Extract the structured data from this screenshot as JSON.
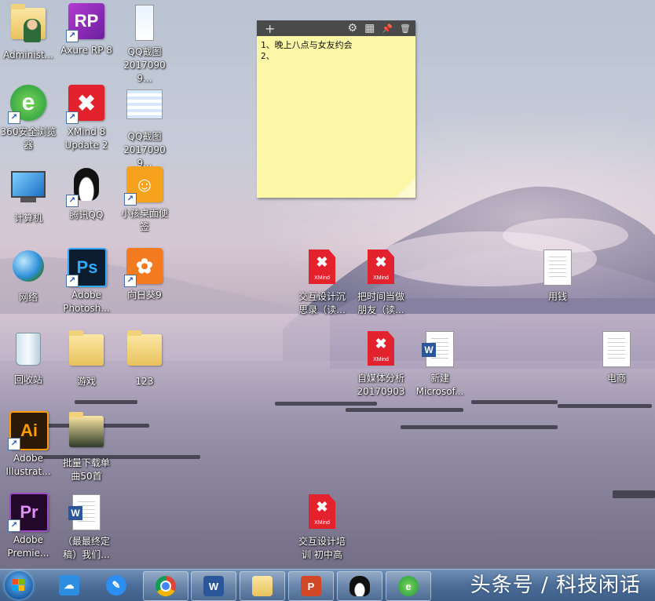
{
  "desktop_icons": [
    {
      "id": "admin",
      "label": "Administ..."
    },
    {
      "id": "axure",
      "label": "Axure RP 8"
    },
    {
      "id": "qqshot1",
      "label": "QQ截图\n20170909..."
    },
    {
      "id": "ie360",
      "label": "360安全浏览\n器"
    },
    {
      "id": "xmind8",
      "label": "XMind 8\nUpdate 2"
    },
    {
      "id": "qqshot2",
      "label": "QQ截图\n20170909..."
    },
    {
      "id": "computer",
      "label": "计算机"
    },
    {
      "id": "tencentqq",
      "label": "腾讯QQ"
    },
    {
      "id": "smallsticky",
      "label": "小孩桌面便\n签"
    },
    {
      "id": "network",
      "label": "网络"
    },
    {
      "id": "photoshop",
      "label": "Adobe\nPhotosh..."
    },
    {
      "id": "sunflower",
      "label": "向日葵9"
    },
    {
      "id": "xmind_jhsj",
      "label": "交互设计沉\n思录（读..."
    },
    {
      "id": "xmind_bsj",
      "label": "把时间当做\n朋友（读..."
    },
    {
      "id": "yongqian",
      "label": "用钱"
    },
    {
      "id": "recycle",
      "label": "回收站"
    },
    {
      "id": "games",
      "label": "游戏"
    },
    {
      "id": "f123",
      "label": "123"
    },
    {
      "id": "xmind_zmt",
      "label": "自媒体分析\n20170903"
    },
    {
      "id": "newword",
      "label": "新建\nMicrosof..."
    },
    {
      "id": "dianshang",
      "label": "电商"
    },
    {
      "id": "illustrator",
      "label": "Adobe\nIllustrat..."
    },
    {
      "id": "batchdl",
      "label": "批量下载单\n曲50首"
    },
    {
      "id": "premiere",
      "label": "Adobe\nPremie..."
    },
    {
      "id": "finaldoc",
      "label": "（最最终定\n稿）我们..."
    },
    {
      "id": "xmind_jhpx",
      "label": "交互设计培\n训 初中高"
    }
  ],
  "sticky_note": {
    "toolbar": {
      "add": "+",
      "settings": "⚙",
      "grid": "▦",
      "pin": "📌",
      "delete": "🗑"
    },
    "line1": "1、晚上八点与女友约会",
    "line2": "2、"
  },
  "icon_text": {
    "axure": "RP",
    "photoshop": "Ps",
    "illustrator": "Ai",
    "premiere": "Pr",
    "xmind_mark": "✖",
    "xmind_sub": "XMind",
    "word": "W"
  },
  "taskbar": {
    "watermark": "头条号 / 科技闲话",
    "apps": [
      "baidu-cloud",
      "note",
      "chrome",
      "word",
      "explorer",
      "powerpoint",
      "qq",
      "360browser"
    ]
  },
  "colors": {
    "taskbar": "#4b6d98",
    "note": "#fdf7a8",
    "xmind": "#e3222d"
  }
}
